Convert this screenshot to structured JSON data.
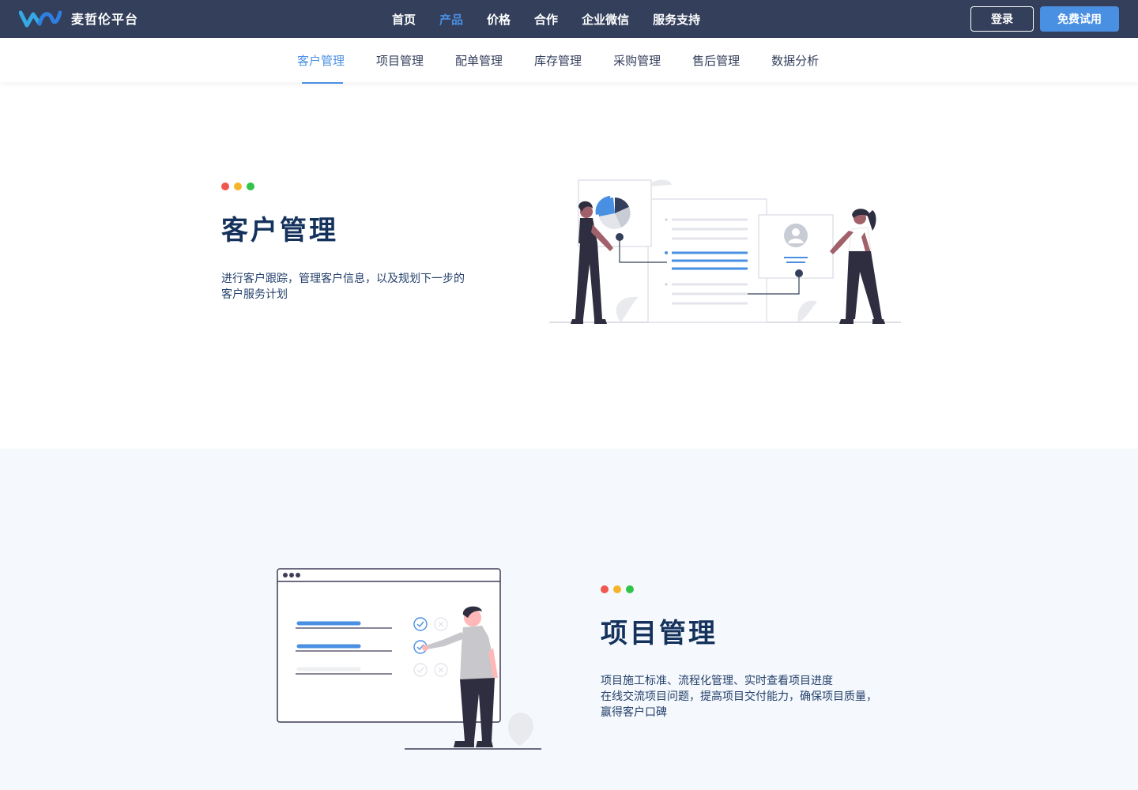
{
  "brand": {
    "name": "麦哲伦平台"
  },
  "main_nav": [
    {
      "label": "首页",
      "active": false
    },
    {
      "label": "产品",
      "active": true
    },
    {
      "label": "价格",
      "active": false
    },
    {
      "label": "合作",
      "active": false
    },
    {
      "label": "企业微信",
      "active": false
    },
    {
      "label": "服务支持",
      "active": false
    }
  ],
  "actions": {
    "login": "登录",
    "trial": "免费试用"
  },
  "sub_nav": [
    {
      "label": "客户管理",
      "active": true
    },
    {
      "label": "项目管理",
      "active": false
    },
    {
      "label": "配单管理",
      "active": false
    },
    {
      "label": "库存管理",
      "active": false
    },
    {
      "label": "采购管理",
      "active": false
    },
    {
      "label": "售后管理",
      "active": false
    },
    {
      "label": "数据分析",
      "active": false
    }
  ],
  "features": [
    {
      "title": "客户管理",
      "desc_lines": [
        "进行客户跟踪，管理客户信息，以及规划下一步的",
        "客户服务计划"
      ]
    },
    {
      "title": "项目管理",
      "desc_lines": [
        "项目施工标准、流程化管理、实时查看项目进度",
        "在线交流项目问题，提高项目交付能力，确保项目质量，",
        "赢得客户口碑"
      ]
    }
  ],
  "colors": {
    "topbar": "#333f5b",
    "accent": "#4a90e2",
    "title": "#14325c",
    "section_alt_bg": "#f5f8fc",
    "dot_red": "#f0574f",
    "dot_yellow": "#f5b52a",
    "dot_green": "#31c449"
  },
  "icons": {
    "logo": "brand-logo-icon",
    "window_dots": "traffic-light-dots-icon"
  }
}
